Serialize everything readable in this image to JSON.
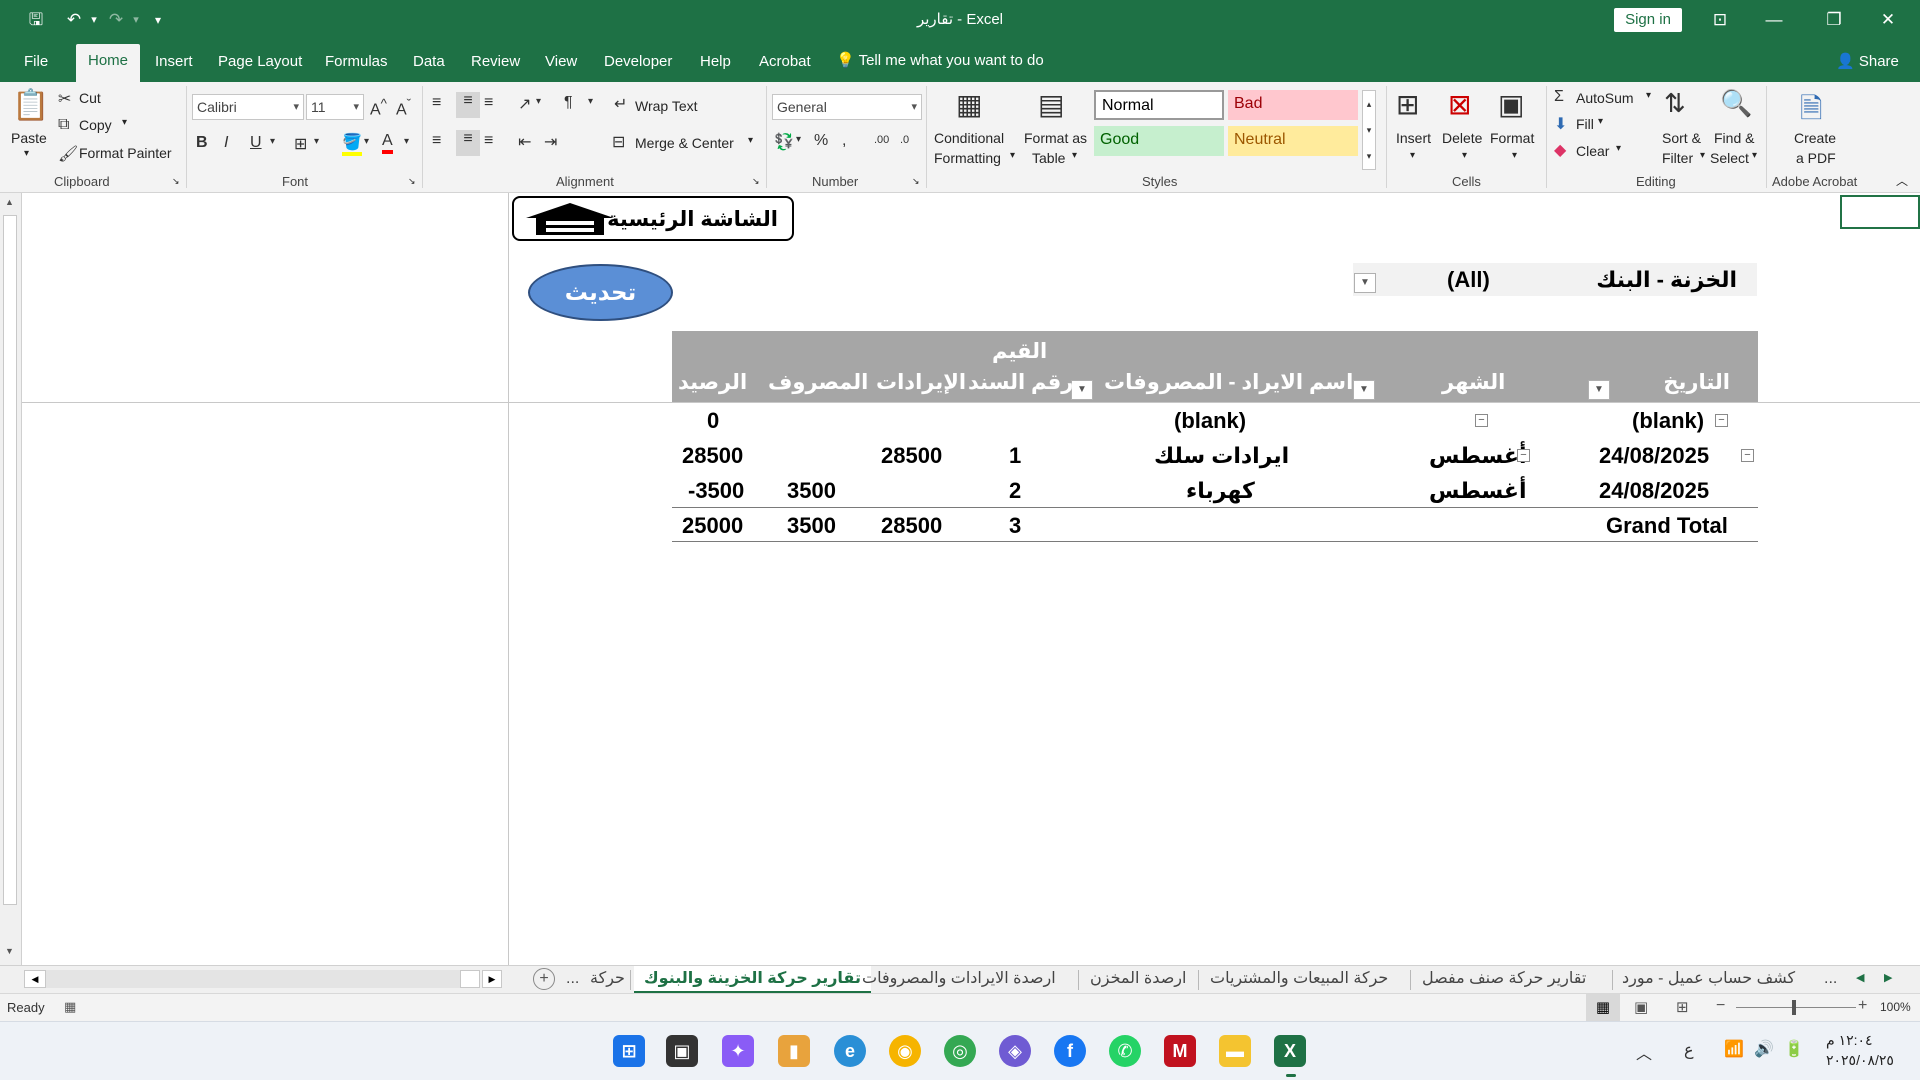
{
  "titlebar": {
    "title": "تقارير  -  Excel",
    "sign_in": "Sign in"
  },
  "tabs": [
    "File",
    "Home",
    "Insert",
    "Page Layout",
    "Formulas",
    "Data",
    "Review",
    "View",
    "Developer",
    "Help",
    "Acrobat"
  ],
  "tell_me": "Tell me what you want to do",
  "share": "Share",
  "ribbon": {
    "clipboard": {
      "paste": "Paste",
      "cut": "Cut",
      "copy": "Copy",
      "format_painter": "Format Painter",
      "label": "Clipboard"
    },
    "font": {
      "name": "Calibri",
      "size": "11",
      "label": "Font"
    },
    "alignment": {
      "wrap_text": "Wrap Text",
      "merge_center": "Merge & Center",
      "label": "Alignment"
    },
    "number": {
      "format": "General",
      "label": "Number"
    },
    "styles": {
      "conditional_1": "Conditional",
      "conditional_2": "Formatting",
      "format_as_1": "Format as",
      "format_as_2": "Table",
      "normal": "Normal",
      "bad": "Bad",
      "good": "Good",
      "neutral": "Neutral",
      "label": "Styles"
    },
    "cells": {
      "insert": "Insert",
      "delete": "Delete",
      "format": "Format",
      "label": "Cells"
    },
    "editing": {
      "autosum": "AutoSum",
      "fill": "Fill",
      "clear": "Clear",
      "sort_1": "Sort &",
      "sort_2": "Filter",
      "find_1": "Find &",
      "find_2": "Select",
      "label": "Editing"
    },
    "acrobat": {
      "create_1": "Create",
      "create_2": "a PDF",
      "label": "Adobe Acrobat"
    }
  },
  "sheet": {
    "home_button": "الشاشة الرئيسية",
    "refresh_button": "تحديث",
    "filter_label": "الخزنة - البنك",
    "filter_value": "(All)",
    "values_header": "القيم",
    "headers": {
      "date": "التاريخ",
      "month": "الشهر",
      "name": "اسم الايراد - المصروفات",
      "voucher": "رقم السند",
      "revenue": "الإيرادات",
      "expense": "المصروف",
      "balance": "الرصيد"
    },
    "rows": [
      {
        "date": "(blank)",
        "month": "",
        "name": "(blank)",
        "voucher": "",
        "revenue": "",
        "expense": "",
        "balance": "0"
      },
      {
        "date": "24/08/2025",
        "month": "أغسطس",
        "name": "ايرادات سلك",
        "voucher": "1",
        "revenue": "28500",
        "expense": "",
        "balance": "28500"
      },
      {
        "date": "24/08/2025",
        "month": "أغسطس",
        "name": "كهرباء",
        "voucher": "2",
        "revenue": "",
        "expense": "3500",
        "balance": "-3500"
      }
    ],
    "grand_total": {
      "label": "Grand Total",
      "voucher": "3",
      "revenue": "28500",
      "expense": "3500",
      "balance": "25000"
    }
  },
  "sheet_tabs": {
    "ellipsis_left": "...",
    "items": [
      "حركة",
      "تقارير حركة الخزينة والبنوك",
      "ارصدة الايرادات والمصروفات",
      "ارصدة المخزن",
      "حركة المبيعات والمشتريات",
      "تقارير حركة صنف مفصل",
      "كشف حساب عميل - مورد"
    ],
    "ellipsis_right": "..."
  },
  "status": {
    "ready": "Ready",
    "zoom": "100%"
  },
  "taskbar": {
    "lang": "ع",
    "time": "١٢:٠٤ م",
    "date": "٢٠٢٥/٠٨/٢٥"
  }
}
